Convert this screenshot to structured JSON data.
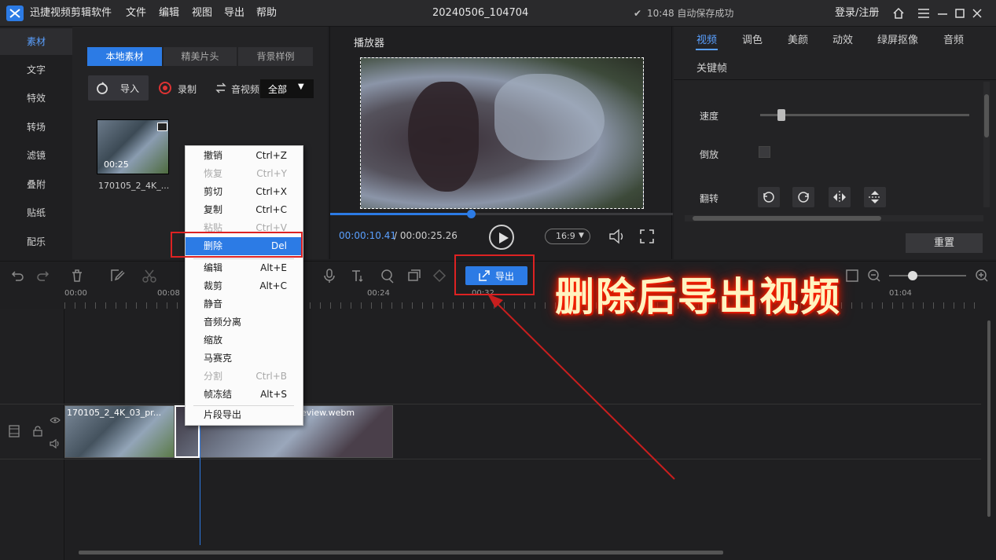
{
  "app": {
    "name": "迅捷视频剪辑软件",
    "menus": [
      "文件",
      "编辑",
      "视图",
      "导出",
      "帮助"
    ],
    "project": "20240506_104704",
    "autosave": "10:48 自动保存成功",
    "login": "登录/注册"
  },
  "leftnav": {
    "items": [
      "素材",
      "文字",
      "特效",
      "转场",
      "滤镜",
      "叠附",
      "贴纸",
      "配乐"
    ]
  },
  "media": {
    "tabs": [
      "本地素材",
      "精美片头",
      "背景样例"
    ],
    "import": "导入",
    "record": "录制",
    "audio": "音视频",
    "filter": "全部",
    "clip_duration": "00:25",
    "clip_name": "170105_2_4K_..."
  },
  "player": {
    "title": "播放器",
    "current": "00:00:10.41",
    "total": "/ 00:00:25.26",
    "ratio": "16:9",
    "progress": 0.41
  },
  "props": {
    "tabs": [
      "视频",
      "调色",
      "美颜",
      "动效",
      "绿屏抠像",
      "音频"
    ],
    "subtab": "关键帧",
    "speed_label": "速度",
    "reverse_label": "倒放",
    "flip_label": "翻转",
    "reset": "重置",
    "speed": 0.1
  },
  "toolbar": {
    "export": "导出"
  },
  "ruler": {
    "ticks": [
      "00:00",
      "00:08",
      "00:24",
      "00:32",
      "01:04"
    ]
  },
  "track": {
    "clip1_label": "170105_2_4K_03_pr...",
    "clip2_label": "eview.webm"
  },
  "contextmenu": {
    "items": [
      {
        "label": "撤销",
        "shortcut": "Ctrl+Z",
        "disabled": false
      },
      {
        "label": "恢复",
        "shortcut": "Ctrl+Y",
        "disabled": true
      },
      {
        "label": "剪切",
        "shortcut": "Ctrl+X",
        "disabled": false
      },
      {
        "label": "复制",
        "shortcut": "Ctrl+C",
        "disabled": false
      },
      {
        "label": "粘贴",
        "shortcut": "Ctrl+V",
        "disabled": true
      },
      {
        "label": "删除",
        "shortcut": "Del",
        "disabled": false
      },
      {
        "label": "编辑",
        "shortcut": "Alt+E",
        "disabled": false
      },
      {
        "label": "裁剪",
        "shortcut": "Alt+C",
        "disabled": false
      },
      {
        "label": "静音",
        "shortcut": "",
        "disabled": false
      },
      {
        "label": "音频分离",
        "shortcut": "",
        "disabled": false
      },
      {
        "label": "缩放",
        "shortcut": "",
        "disabled": false
      },
      {
        "label": "马赛克",
        "shortcut": "",
        "disabled": false
      },
      {
        "label": "分割",
        "shortcut": "Ctrl+B",
        "disabled": true
      },
      {
        "label": "帧冻结",
        "shortcut": "Alt+S",
        "disabled": false
      },
      {
        "label": "片段导出",
        "shortcut": "",
        "disabled": false
      }
    ]
  },
  "annotation": {
    "text": "删除后导出视频"
  },
  "colors": {
    "accent": "#2c7be5",
    "highlight_red": "#dd2222"
  }
}
